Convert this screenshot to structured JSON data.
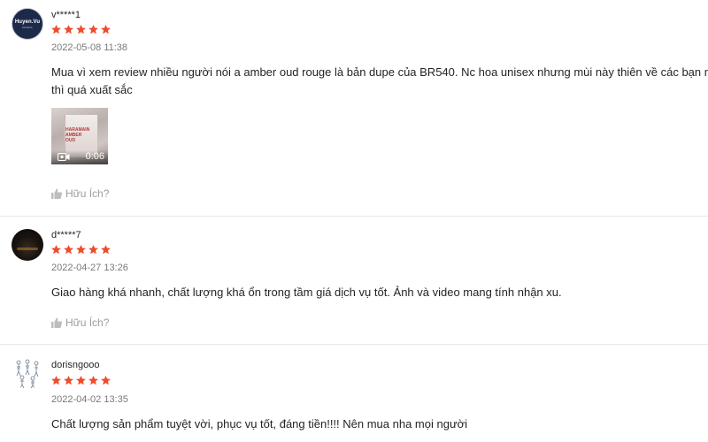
{
  "colors": {
    "star": "#ee4d2d",
    "muted": "#9e9e9e",
    "divider": "#e8e8e8"
  },
  "reviews": [
    {
      "username": "v*****1",
      "avatar": {
        "type": "brand-logo",
        "text": "Huyen.Vu",
        "subtext": "Perfume"
      },
      "rating": 5,
      "date": "2022-05-08 11:38",
      "comment_lines": [
        "Mua vì xem review nhiều người nói a amber oud rouge là bản dupe của BR540. Nc hoa unisex nhưng mùi này thiên về các bạn nam r",
        "thì quá xuất sắc"
      ],
      "video": {
        "box_text": "HARAMAIN\nAMBER\nOUD",
        "duration": "0:06",
        "icon": "video-camera-icon"
      },
      "helpful_label": "Hữu Ích?"
    },
    {
      "username": "d*****7",
      "avatar": {
        "type": "photo-dark"
      },
      "rating": 5,
      "date": "2022-04-27 13:26",
      "comment_lines": [
        "Giao hàng khá nhanh, chất lượng khá ổn trong tầm giá dịch vụ tốt. Ảnh và video mang tính nhận xu."
      ],
      "helpful_label": "Hữu Ích?"
    },
    {
      "username": "dorisngooo",
      "avatar": {
        "type": "sketch"
      },
      "rating": 5,
      "date": "2022-04-02 13:35",
      "comment_lines": [
        "Chất lượng sản phẩm tuyệt vời, phục vụ tốt, đáng tiền!!!! Nên mua nha mọi người"
      ]
    }
  ]
}
